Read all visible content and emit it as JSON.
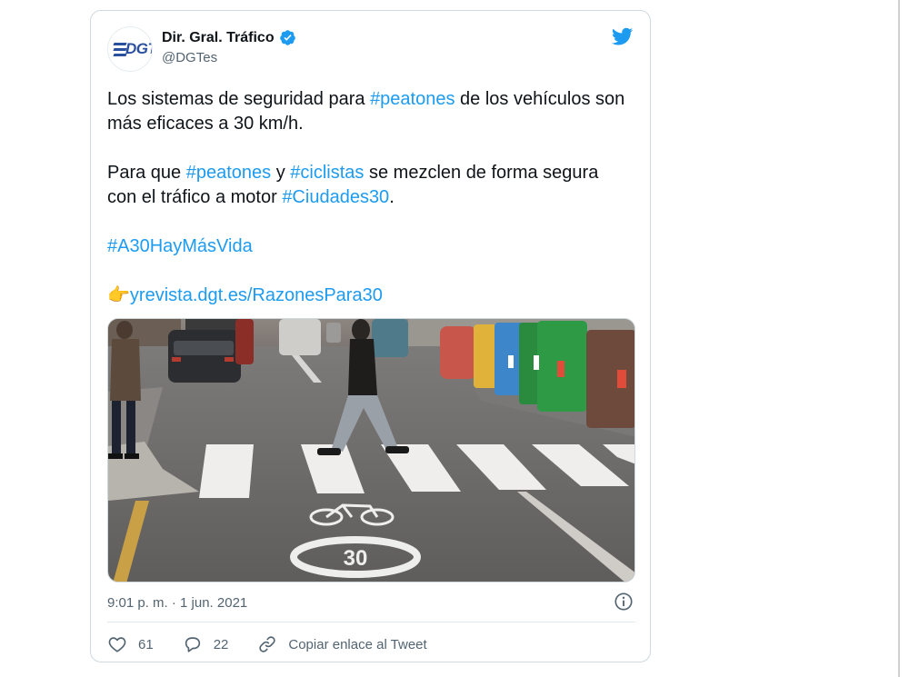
{
  "author": {
    "name": "Dir. Gral. Tráfico",
    "handle": "@DGTes",
    "avatar_text": "DGT",
    "verified": true
  },
  "tweet": {
    "p1": {
      "t1": "Los sistemas de seguridad para ",
      "h1": "#peatones",
      "t2": " de los vehículos son más eficaces a 30 km/h."
    },
    "p2": {
      "t1": "Para que ",
      "h1": "#peatones",
      "t2": " y ",
      "h2": "#ciclistas",
      "t3": " se mezclen de forma segura con el tráfico a motor ",
      "h3": "#Ciudades30",
      "t4": "."
    },
    "p3": {
      "h1": "#A30HayMásVida"
    },
    "p4": {
      "emoji": "👉",
      "link": "yrevista.dgt.es/RazonesPara30"
    }
  },
  "media": {
    "road_sign_number": "30"
  },
  "timestamp": "9:01 p. m. · 1 jun. 2021",
  "actions": {
    "likes": "61",
    "replies": "22",
    "copy_link_label": "Copiar enlace al Tweet"
  },
  "icons": {
    "twitter": "twitter-bird-icon",
    "verified": "verified-badge-icon",
    "info": "info-icon",
    "like": "heart-icon",
    "reply": "reply-bubble-icon",
    "copy": "link-icon"
  },
  "colors": {
    "accent": "#1d9bf0",
    "text": "#0f1419",
    "muted": "#536471",
    "border": "#cfd9de",
    "brand": "#2a4f9e"
  }
}
